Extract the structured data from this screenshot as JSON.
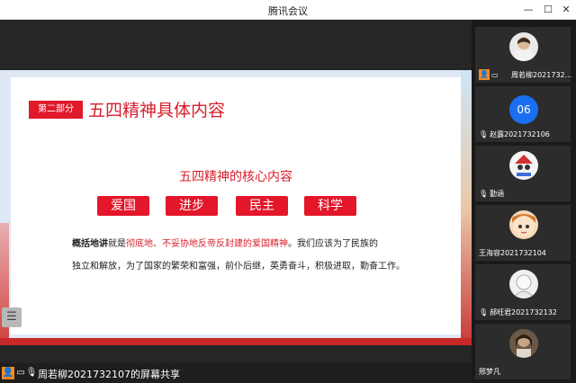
{
  "window": {
    "title": "腾讯会议",
    "min": "—",
    "max": "☐",
    "close": "✕"
  },
  "slide": {
    "tag": "第二部分",
    "heading": "五四精神具体内容",
    "subheading": "五四精神的核心内容",
    "pills": [
      "爱国",
      "进步",
      "民主",
      "科学"
    ],
    "para1_bold": "概括地讲",
    "para1_plain1": "就是",
    "para1_red": "彻底地、不妥协地反帝反封建的爱国精神",
    "para1_plain2": "。我们应该为了民族的",
    "para2": "独立和解放，为了国家的繁荣和富强，前仆后继，英勇奋斗，积极进取，勤奋工作。"
  },
  "menu_handle": "☰",
  "sharebar": {
    "text": "周若柳2021732107的屏幕共享"
  },
  "participants": [
    {
      "name": "周若柳2021732...",
      "avatar": "photo-avatar",
      "host": true
    },
    {
      "name": "赵露2021732106",
      "avatar_text": "06"
    },
    {
      "name": "勤涵",
      "avatar": "cartoon-avatar"
    },
    {
      "name": "王海容2021732104",
      "avatar": "anime-avatar"
    },
    {
      "name": "郝旺君2021732132",
      "avatar": "sketch-avatar"
    },
    {
      "name": "邢梦凡",
      "avatar": "photo-avatar"
    }
  ],
  "colors": {
    "accent_red": "#d81e2b",
    "avatar_blue": "#1a6ff0",
    "host_orange": "#f08a24"
  }
}
